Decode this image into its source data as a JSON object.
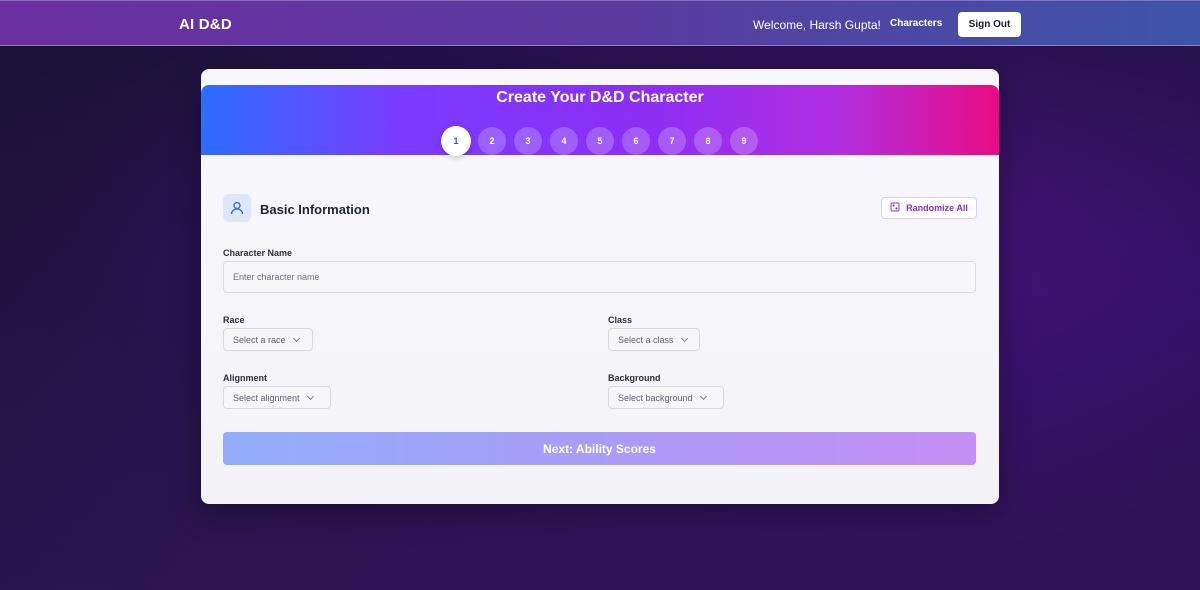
{
  "header": {
    "brand": "AI D&D",
    "welcome": "Welcome, Harsh Gupta!",
    "characters_link": "Characters",
    "signout_label": "Sign Out"
  },
  "wizard": {
    "title": "Create Your D&D Character",
    "steps": [
      "1",
      "2",
      "3",
      "4",
      "5",
      "6",
      "7",
      "8",
      "9"
    ],
    "active_step": 1
  },
  "section": {
    "title": "Basic Information",
    "icon": "user-icon",
    "randomize_label": "Randomize All",
    "randomize_icon": "dice-icon"
  },
  "form": {
    "name_label": "Character Name",
    "name_placeholder": "Enter character name",
    "race_label": "Race",
    "race_value": "Select a race",
    "class_label": "Class",
    "class_value": "Select a class",
    "alignment_label": "Alignment",
    "alignment_value": "Select alignment",
    "background_label": "Background",
    "background_value": "Select background",
    "next_label": "Next: Ability Scores"
  },
  "colors": {
    "accent_start": "#2c6dff",
    "accent_mid": "#8b2ef5",
    "accent_end": "#ea0b84",
    "randomize_text": "#8b2fc9"
  }
}
